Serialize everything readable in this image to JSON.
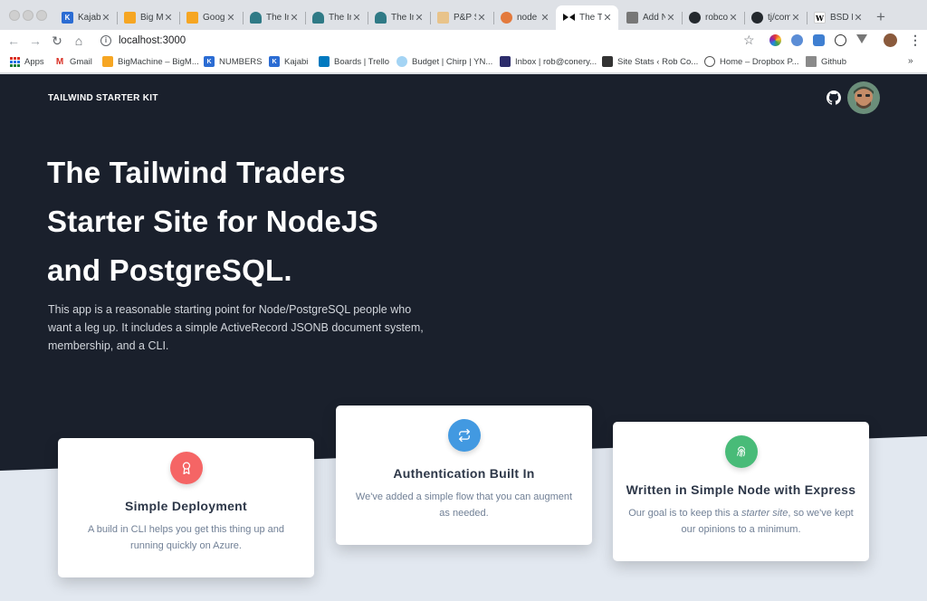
{
  "browser": {
    "tabs": [
      {
        "title": "Kajabi",
        "favicon": "kajabi-icon",
        "active": false
      },
      {
        "title": "Big Machine",
        "favicon": "bigmachine-icon",
        "active": false
      },
      {
        "title": "Google",
        "favicon": "bigmachine-icon",
        "active": false
      },
      {
        "title": "The Imposter",
        "favicon": "imposter-icon",
        "active": false
      },
      {
        "title": "The Imposter",
        "favicon": "imposter-icon",
        "active": false
      },
      {
        "title": "The Imposter",
        "favicon": "imposter-icon",
        "active": false
      },
      {
        "title": "P&P Soap",
        "favicon": "pp-icon",
        "active": false
      },
      {
        "title": "node",
        "favicon": "node-icon",
        "active": false
      },
      {
        "title": "The Tailwind",
        "favicon": "bowtie-icon",
        "active": true
      },
      {
        "title": "Add New",
        "favicon": "add-new-icon",
        "active": false
      },
      {
        "title": "robconery",
        "favicon": "github-icon",
        "active": false
      },
      {
        "title": "tj/commander",
        "favicon": "github-icon",
        "active": false
      },
      {
        "title": "BSD Licenses",
        "favicon": "wikipedia-icon",
        "active": false
      }
    ],
    "new_tab_label": "+",
    "url": "localhost:3000",
    "bookmarks": [
      {
        "label": "Apps",
        "icon": "apps-grid-icon"
      },
      {
        "label": "Gmail",
        "icon": "gmail-icon"
      },
      {
        "label": "BigMachine – BigM...",
        "icon": "bigmachine-icon"
      },
      {
        "label": "NUMBERS",
        "icon": "kajabi-icon"
      },
      {
        "label": "Kajabi",
        "icon": "kajabi-icon"
      },
      {
        "label": "Boards | Trello",
        "icon": "trello-icon"
      },
      {
        "label": "Budget | Chirp | YN...",
        "icon": "ynab-icon"
      },
      {
        "label": "Inbox | rob@conery...",
        "icon": "inbox-icon"
      },
      {
        "label": "Site Stats ‹ Rob Co...",
        "icon": "wordpress-icon"
      },
      {
        "label": "Home – Dropbox P...",
        "icon": "globe-icon"
      },
      {
        "label": "Github",
        "icon": "folder-icon"
      }
    ],
    "bookmarks_more": "»"
  },
  "site": {
    "brand": "TAILWIND STARTER KIT",
    "hero_title_lines": [
      "The Tailwind Traders",
      "Starter Site for NodeJS",
      "and PostgreSQL."
    ],
    "hero_desc": "This app is a reasonable starting point for Node/PostgreSQL people who want a leg up. It includes a simple ActiveRecord JSONB document system, membership, and a CLI.",
    "cards": [
      {
        "title": "Simple Deployment",
        "desc": "A build in CLI helps you get this thing up and running quickly on Azure.",
        "icon": "award-icon",
        "color": "#f56565"
      },
      {
        "title": "Authentication Built In",
        "desc": "We've added a simple flow that you can augment as needed.",
        "icon": "repeat-icon",
        "color": "#4299e1"
      },
      {
        "title": "Written in Simple Node with Express",
        "desc_before": "Our goal is to keep this a ",
        "desc_em": "starter site",
        "desc_after": ", so we've kept our opinions to a minimum.",
        "icon": "fingerprint-icon",
        "color": "#48bb78"
      }
    ]
  },
  "colors": {
    "hero_bg": "#1a202c",
    "lower_bg": "#e2e8f0"
  }
}
